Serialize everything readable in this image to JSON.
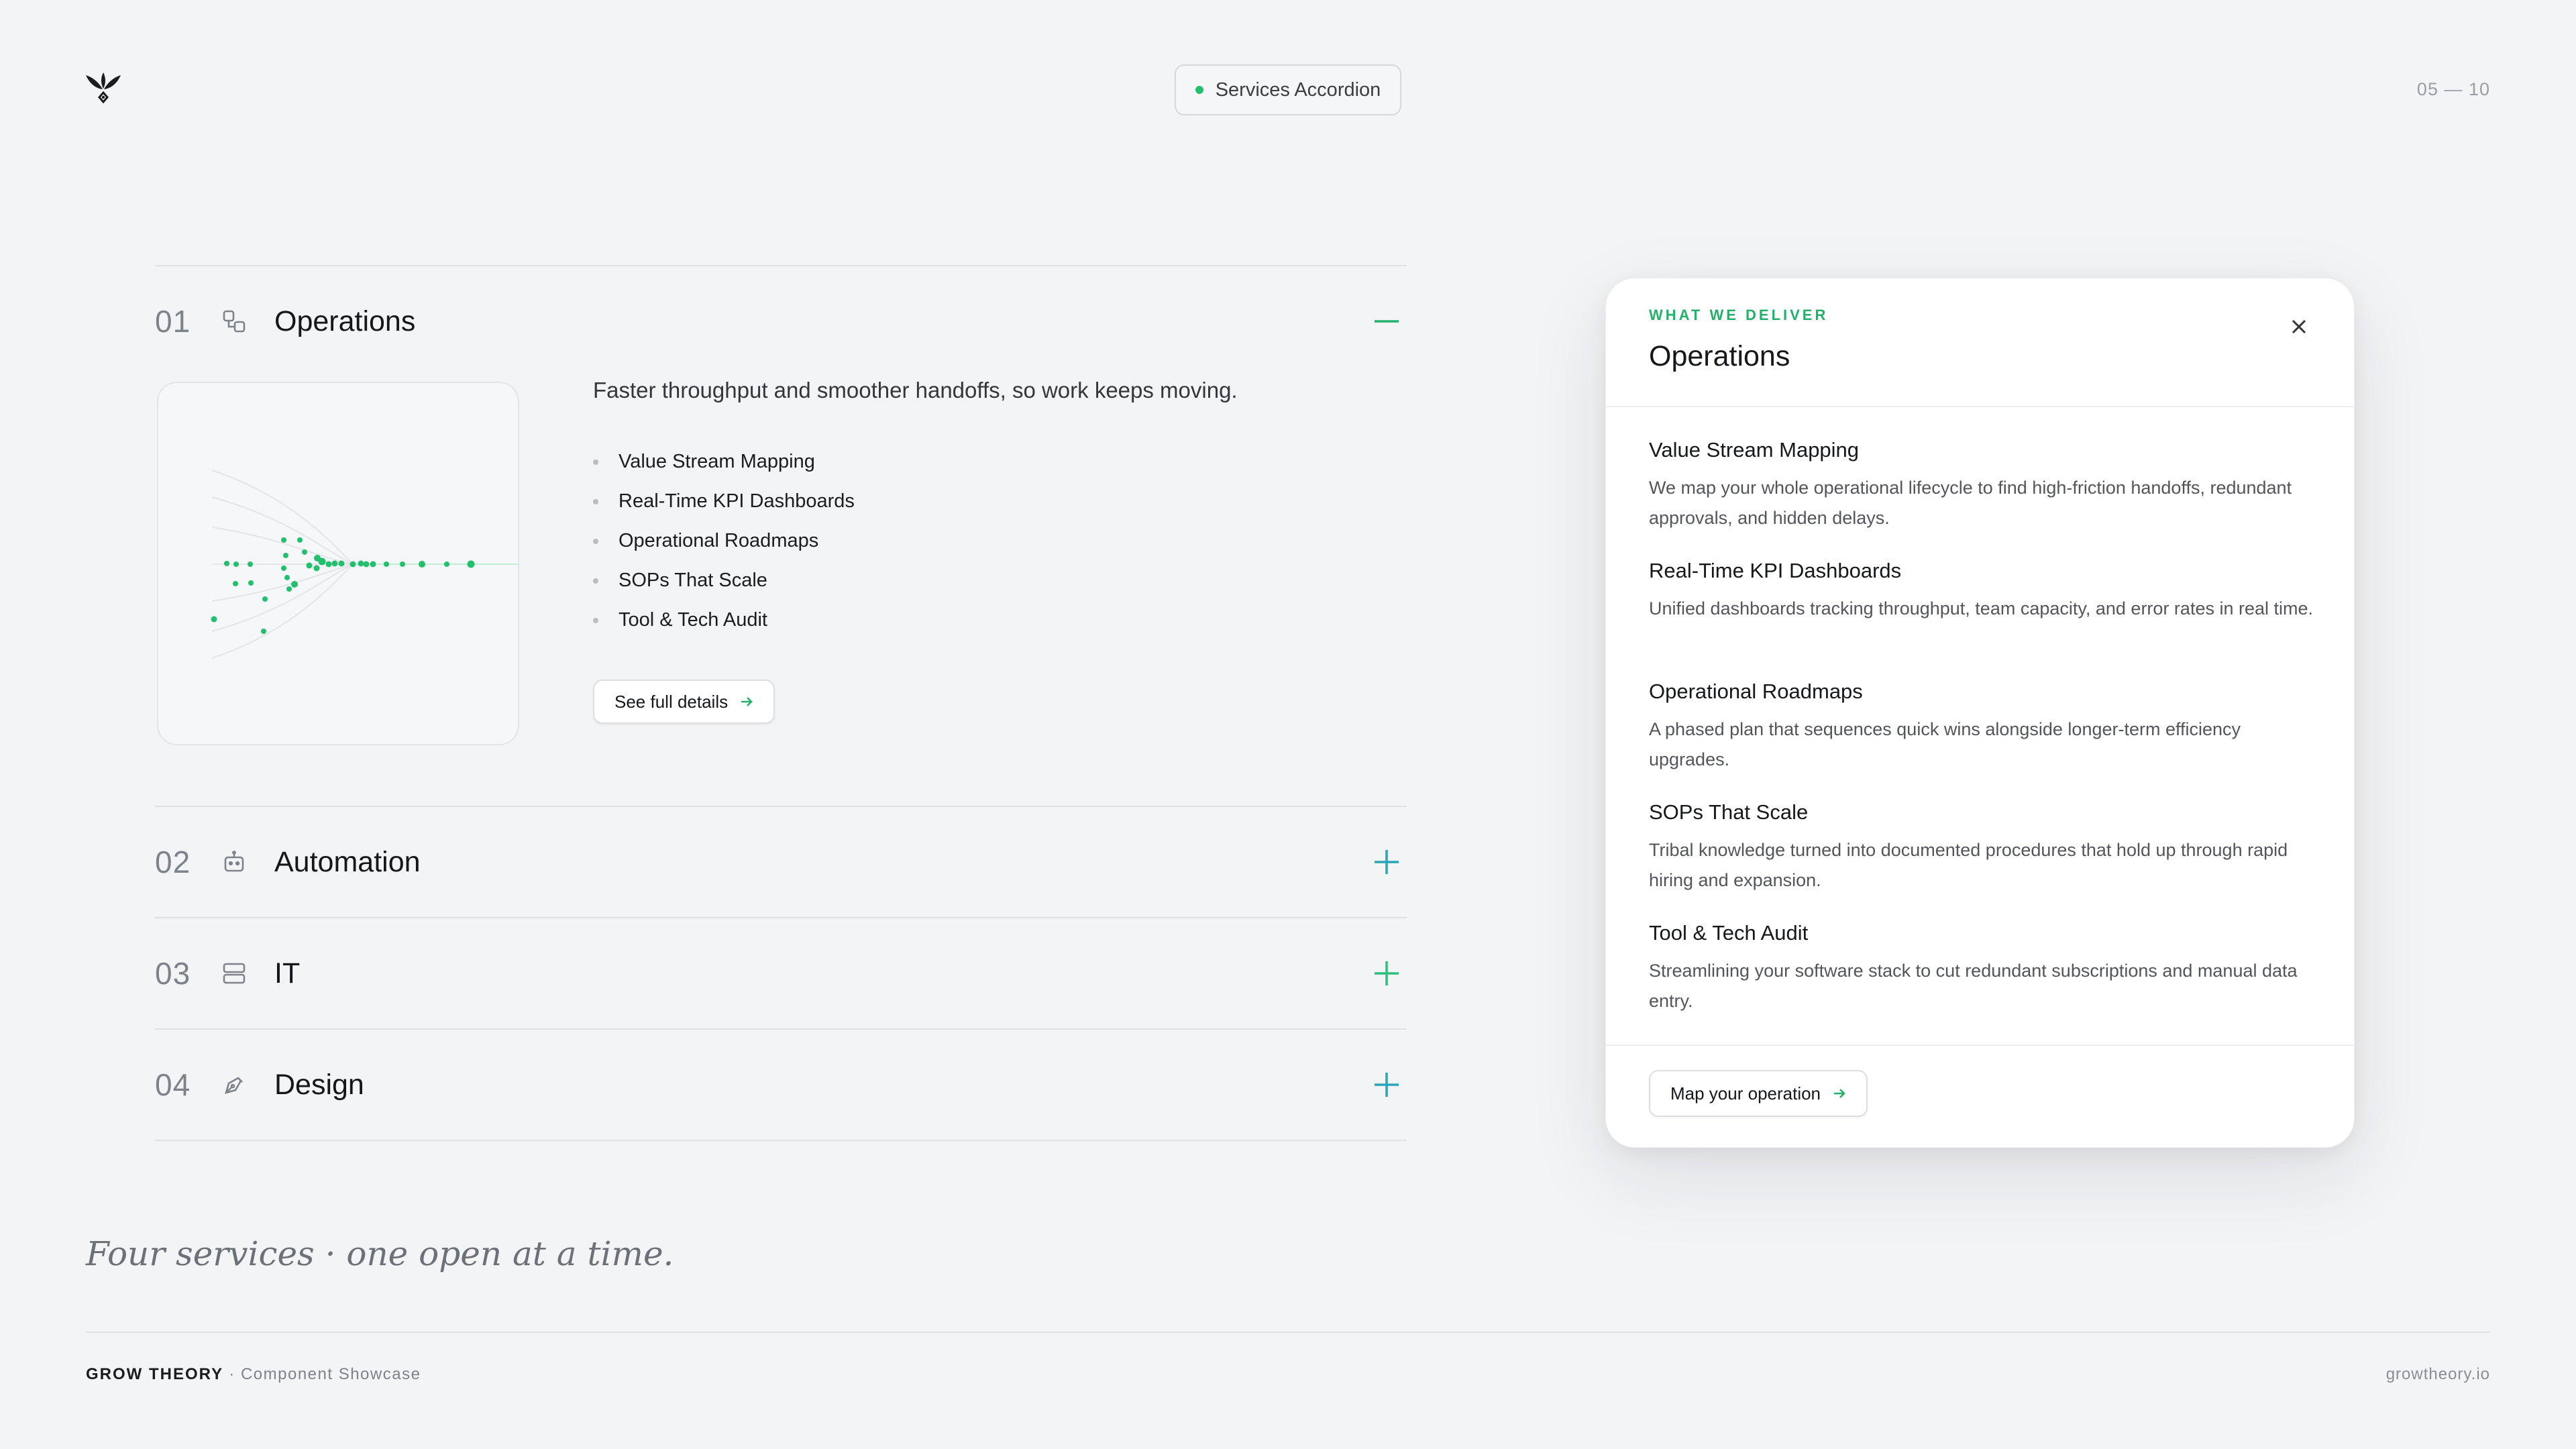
{
  "header": {
    "pill_label": "Services Accordion",
    "pager": "05 — 10"
  },
  "accordion": {
    "items": [
      {
        "number": "01",
        "title": "Operations",
        "icon": "workflow-icon",
        "expanded": true,
        "description": "Faster throughput and smoother handoffs, so work keeps moving.",
        "features": [
          "Value Stream Mapping",
          "Real-Time KPI Dashboards",
          "Operational Roadmaps",
          "SOPs That Scale",
          "Tool & Tech Audit"
        ],
        "cta": "See full details"
      },
      {
        "number": "02",
        "title": "Automation",
        "icon": "robot-icon",
        "expanded": false
      },
      {
        "number": "03",
        "title": "IT",
        "icon": "server-icon",
        "expanded": false
      },
      {
        "number": "04",
        "title": "Design",
        "icon": "pen-tool-icon",
        "expanded": false
      }
    ]
  },
  "card": {
    "eyebrow": "WHAT WE DELIVER",
    "title": "Operations",
    "items": [
      {
        "title": "Value Stream Mapping",
        "body": "We map your whole operational lifecycle to find high-friction handoffs, redundant approvals, and hidden delays."
      },
      {
        "title": "Real-Time KPI Dashboards",
        "body": "Unified dashboards tracking throughput, team capacity, and error rates in real time."
      },
      {
        "title": "Operational Roadmaps",
        "body": "A phased plan that sequences quick wins alongside longer-term efficiency upgrades."
      },
      {
        "title": "SOPs That Scale",
        "body": "Tribal knowledge turned into documented procedures that hold up through rapid hiring and expansion."
      },
      {
        "title": "Tool & Tech Audit",
        "body": "Streamlining your software stack to cut redundant subscriptions and manual data entry."
      }
    ],
    "cta": "Map your operation"
  },
  "tagline": "Four services · one open at a time.",
  "footer": {
    "brand": "GROW THEORY",
    "separator": "·",
    "subtitle": "Component Showcase",
    "site": "growtheory.io"
  },
  "colors": {
    "accent_green": "#22c06e",
    "accent_teal": "#2aa5b8",
    "background": "#f3f4f6"
  }
}
